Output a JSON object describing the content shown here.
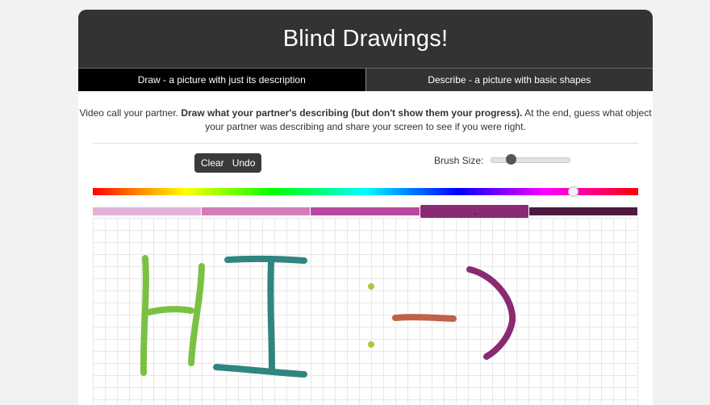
{
  "app": {
    "title": "Blind Drawings!"
  },
  "tabs": [
    {
      "label": "Draw - a picture with just its description",
      "active": true
    },
    {
      "label": "Describe - a picture with basic shapes",
      "active": false
    }
  ],
  "instructions": {
    "part1": "Video call your partner. ",
    "part2_bold": "Draw what your partner's describing (but don't show them your progress).",
    "part3": " At the end, guess what object",
    "line2": "your partner was describing and share your screen to see if you were right."
  },
  "toolbar": {
    "clear_label": "Clear",
    "undo_label": "Undo",
    "brush_size_label": "Brush Size:"
  },
  "brush_size": {
    "value_fraction": 0.22
  },
  "color_picker": {
    "hue_fraction": 0.88,
    "shades": [
      "#e3b2d8",
      "#d47bb9",
      "#b9489f",
      "#8a2a73",
      "#4d1a3f"
    ],
    "selected_shade_index": 3
  },
  "drawing": {
    "strokes": [
      {
        "name": "letter-h-left-stroke",
        "color": "#7ac142"
      },
      {
        "name": "letter-h-right-stroke",
        "color": "#7ac142"
      },
      {
        "name": "letter-h-crossbar-stroke",
        "color": "#7ac142"
      },
      {
        "name": "letter-i-top-stroke",
        "color": "#2f8580"
      },
      {
        "name": "letter-i-vertical-stroke",
        "color": "#2f8580"
      },
      {
        "name": "letter-i-bottom-stroke",
        "color": "#2f8580"
      },
      {
        "name": "colon-top-dot",
        "color": "#b8c23a"
      },
      {
        "name": "colon-bottom-dot",
        "color": "#b8c23a"
      },
      {
        "name": "dash-stroke",
        "color": "#c0614a"
      },
      {
        "name": "parenthesis-stroke",
        "color": "#8a2a73"
      }
    ]
  }
}
